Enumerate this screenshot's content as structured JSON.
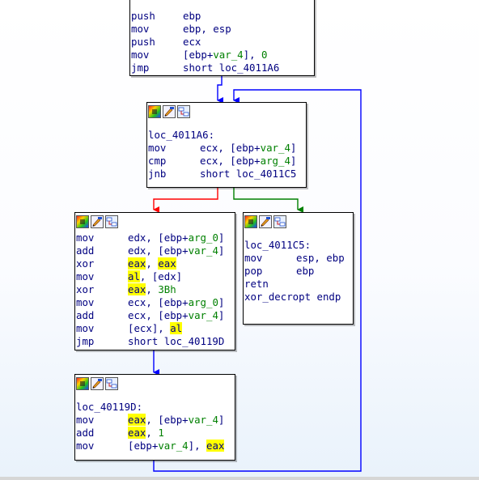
{
  "header_icons": [
    "graph-color-icon",
    "edit-node-icon",
    "group-node-icon"
  ],
  "colors": {
    "mnemonic": "#000080",
    "variable": "#008000",
    "highlight": "#ffff00",
    "edge_false": "#ff0000",
    "edge_true": "#008000",
    "edge_jump": "#0000ff"
  },
  "blocks": [
    {
      "id": "entry",
      "lines": [
        [
          {
            "t": "push",
            "c": "m"
          },
          {
            "t": "ebp"
          }
        ],
        [
          {
            "t": "mov",
            "c": "m"
          },
          {
            "t": "ebp, esp"
          }
        ],
        [
          {
            "t": "push",
            "c": "m"
          },
          {
            "t": "ecx"
          }
        ],
        [
          {
            "t": "mov",
            "c": "m"
          },
          {
            "t": "[ebp+"
          },
          {
            "t": "var_4",
            "c": "var"
          },
          {
            "t": "], "
          },
          {
            "t": "0",
            "c": "num"
          }
        ],
        [
          {
            "t": "jmp",
            "c": "m"
          },
          {
            "t": "short loc_4011A6"
          }
        ]
      ]
    },
    {
      "id": "loc_4011A6",
      "lines": [
        [
          {
            "t": "",
            "c": "blank"
          }
        ],
        [
          {
            "t": "loc_4011A6:"
          }
        ],
        [
          {
            "t": "mov",
            "c": "m"
          },
          {
            "t": "ecx, [ebp+"
          },
          {
            "t": "var_4",
            "c": "var"
          },
          {
            "t": "]"
          }
        ],
        [
          {
            "t": "cmp",
            "c": "m"
          },
          {
            "t": "ecx, [ebp+"
          },
          {
            "t": "arg_4",
            "c": "var"
          },
          {
            "t": "]"
          }
        ],
        [
          {
            "t": "jnb",
            "c": "m"
          },
          {
            "t": "short loc_4011C5"
          }
        ]
      ]
    },
    {
      "id": "body",
      "lines": [
        [
          {
            "t": "mov",
            "c": "m"
          },
          {
            "t": "edx, [ebp+"
          },
          {
            "t": "arg_0",
            "c": "var"
          },
          {
            "t": "]"
          }
        ],
        [
          {
            "t": "add",
            "c": "m"
          },
          {
            "t": "edx, [ebp+"
          },
          {
            "t": "var_4",
            "c": "var"
          },
          {
            "t": "]"
          }
        ],
        [
          {
            "t": "xor",
            "c": "m"
          },
          {
            "t": "eax",
            "c": "hl"
          },
          {
            "t": ", "
          },
          {
            "t": "eax",
            "c": "hl"
          }
        ],
        [
          {
            "t": "mov",
            "c": "m"
          },
          {
            "t": "al",
            "c": "hl"
          },
          {
            "t": ", [edx]"
          }
        ],
        [
          {
            "t": "xor",
            "c": "m"
          },
          {
            "t": "eax",
            "c": "hl"
          },
          {
            "t": ", "
          },
          {
            "t": "3Bh",
            "c": "num"
          }
        ],
        [
          {
            "t": "mov",
            "c": "m"
          },
          {
            "t": "ecx, [ebp+"
          },
          {
            "t": "arg_0",
            "c": "var"
          },
          {
            "t": "]"
          }
        ],
        [
          {
            "t": "add",
            "c": "m"
          },
          {
            "t": "ecx, [ebp+"
          },
          {
            "t": "var_4",
            "c": "var"
          },
          {
            "t": "]"
          }
        ],
        [
          {
            "t": "mov",
            "c": "m"
          },
          {
            "t": "[ecx], "
          },
          {
            "t": "al",
            "c": "hl"
          }
        ],
        [
          {
            "t": "jmp",
            "c": "m"
          },
          {
            "t": "short loc_40119D"
          }
        ]
      ]
    },
    {
      "id": "loc_4011C5",
      "lines": [
        [
          {
            "t": "",
            "c": "blank"
          }
        ],
        [
          {
            "t": "loc_4011C5:"
          }
        ],
        [
          {
            "t": "mov",
            "c": "m"
          },
          {
            "t": "esp, ebp"
          }
        ],
        [
          {
            "t": "pop",
            "c": "m"
          },
          {
            "t": "ebp"
          }
        ],
        [
          {
            "t": "retn",
            "c": "m"
          }
        ],
        [
          {
            "t": "xor_decropt endp"
          }
        ]
      ]
    },
    {
      "id": "loc_40119D",
      "lines": [
        [
          {
            "t": "",
            "c": "blank"
          }
        ],
        [
          {
            "t": "loc_40119D:"
          }
        ],
        [
          {
            "t": "mov",
            "c": "m"
          },
          {
            "t": "eax",
            "c": "hl"
          },
          {
            "t": ", [ebp+"
          },
          {
            "t": "var_4",
            "c": "var"
          },
          {
            "t": "]"
          }
        ],
        [
          {
            "t": "add",
            "c": "m"
          },
          {
            "t": "eax",
            "c": "hl"
          },
          {
            "t": ", "
          },
          {
            "t": "1",
            "c": "num"
          }
        ],
        [
          {
            "t": "mov",
            "c": "m"
          },
          {
            "t": "[ebp+"
          },
          {
            "t": "var_4",
            "c": "var"
          },
          {
            "t": "], "
          },
          {
            "t": "eax",
            "c": "hl"
          }
        ]
      ]
    }
  ]
}
